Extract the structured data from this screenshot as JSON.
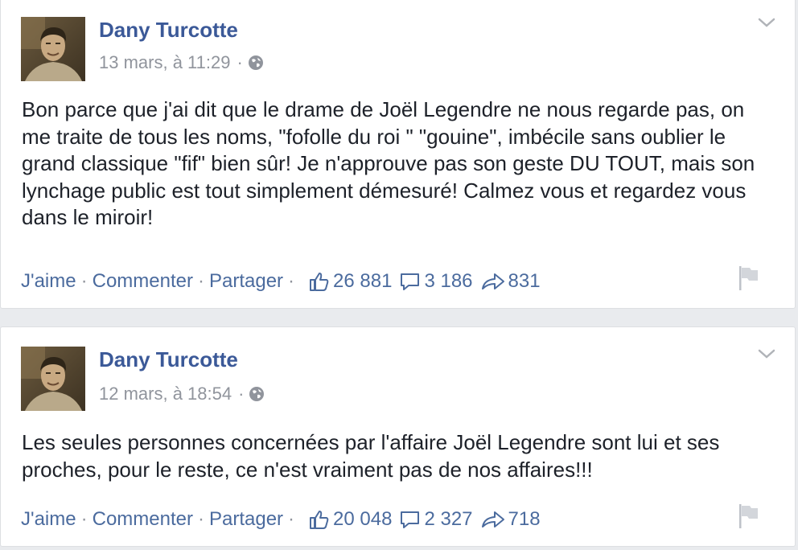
{
  "posts": [
    {
      "author": "Dany Turcotte",
      "timestamp": "13 mars, à 11:29",
      "separator": "·",
      "privacy_icon": "globe-icon",
      "text": "Bon parce que j'ai dit que le drame de Joël Legendre ne nous regarde pas, on me traite de tous les noms, \"fofolle du roi \" \"gouine\", imbécile sans oublier le grand classique \"fif\" bien sûr! Je n'approuve pas son geste DU TOUT, mais son lynchage public est tout simplement démesuré! Calmez vous et regardez vous dans le miroir!",
      "actions": {
        "like": "J'aime",
        "comment": "Commenter",
        "share": "Partager"
      },
      "stats": {
        "likes": "26 881",
        "comments": "3 186",
        "shares": "831"
      }
    },
    {
      "author": "Dany Turcotte",
      "timestamp": "12 mars, à 18:54",
      "separator": "·",
      "privacy_icon": "globe-icon",
      "text": "Les seules personnes concernées par l'affaire Joël Legendre sont lui et ses proches, pour le reste, ce n'est vraiment pas de nos affaires!!!",
      "actions": {
        "like": "J'aime",
        "comment": "Commenter",
        "share": "Partager"
      },
      "stats": {
        "likes": "20 048",
        "comments": "2 327",
        "shares": "718"
      }
    }
  ],
  "colors": {
    "link": "#3b5998",
    "action": "#4b6b9e",
    "meta": "#90949c",
    "text": "#1d2129",
    "background": "#e9ebee"
  }
}
